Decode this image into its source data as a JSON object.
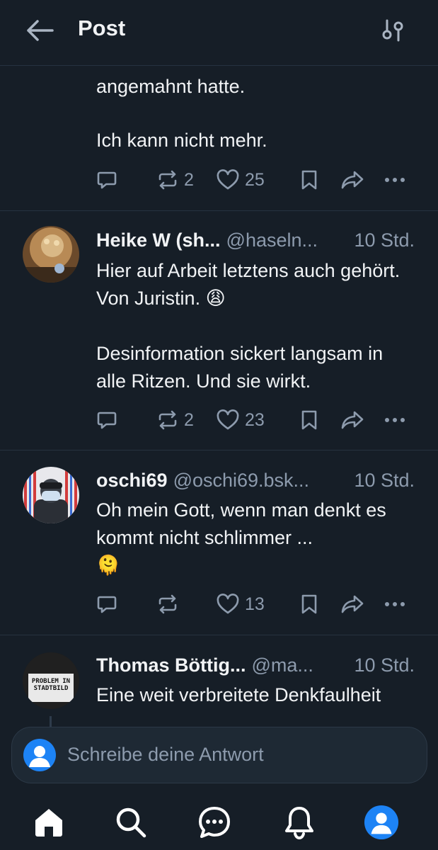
{
  "header": {
    "title": "Post",
    "back_icon": "arrow-left-icon",
    "settings_icon": "sliders-icon"
  },
  "continuation": {
    "text": "angemahnt hatte.\n\nIch kann nicht mehr.",
    "reposts": "2",
    "likes": "25"
  },
  "replies": [
    {
      "display_name": "Heike W (sh...",
      "handle": "@haseln...",
      "time": "10 Std.",
      "text": "Hier auf Arbeit letztens auch gehört. Von Juristin. 😩\n\nDesinformation sickert langsam in alle Ritzen. Und sie wirkt.",
      "reposts": "2",
      "likes": "23"
    },
    {
      "display_name": "oschi69",
      "handle": "@oschi69.bsk...",
      "time": "10 Std.",
      "text": "Oh mein Gott, wenn man denkt es kommt nicht schlimmer ...\n🫠",
      "reposts": "",
      "likes": "13"
    },
    {
      "display_name": "Thomas Böttig...",
      "handle": "@ma...",
      "time": "10 Std.",
      "text": "Eine weit verbreitete Denkfaulheit",
      "avatar_text": "PROBLEM IN STADTBILD"
    }
  ],
  "composer": {
    "placeholder": "Schreibe deine Antwort"
  },
  "nav": {
    "items": [
      "home-icon",
      "search-icon",
      "chat-icon",
      "bell-icon",
      "profile-icon"
    ]
  },
  "colors": {
    "background": "#161e27",
    "muted": "#8d9bad",
    "accent": "#1d83f5"
  }
}
